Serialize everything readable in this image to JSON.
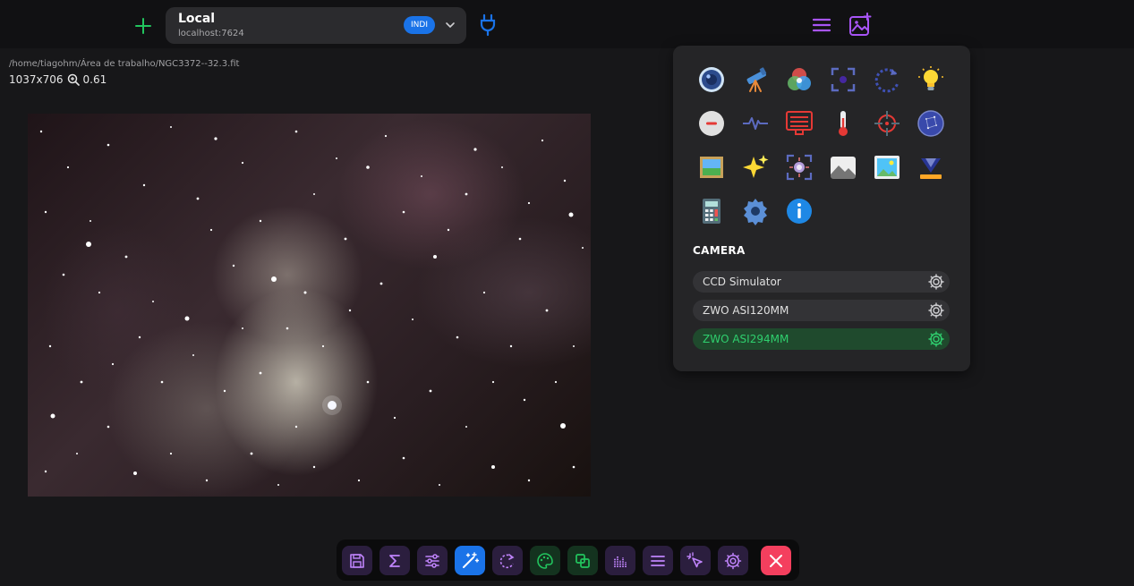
{
  "header": {
    "connection_name": "Local",
    "connection_host": "localhost:7624",
    "connection_badge": "INDI",
    "icons": [
      "add-icon",
      "chevron-down-icon",
      "plug-icon",
      "menu-icon",
      "image-add-icon"
    ],
    "accent_green": "#22c55e",
    "accent_purple": "#a855f7",
    "accent_blue": "#1a73e8"
  },
  "image_info": {
    "path": "/home/tiagohm/Área de trabalho/NGC3372--32.3.fit",
    "resolution": "1037x706",
    "zoom": "0.61"
  },
  "panel": {
    "icons": [
      "camera-lens-icon",
      "telescope-icon",
      "color-filter-icon",
      "focus-icon",
      "rotator-icon",
      "light-bulb-icon",
      "dew-heater-icon",
      "signal-icon",
      "flat-panel-icon",
      "thermometer-icon",
      "crosshair-icon",
      "sky-atlas-icon",
      "framing-icon",
      "sparkles-icon",
      "autofocus-icon",
      "image-icon",
      "image-viewer-icon",
      "dome-icon",
      "calculator-icon",
      "settings-icon",
      "info-icon"
    ],
    "section_title": "CAMERA",
    "cameras": [
      {
        "label": "CCD Simulator",
        "active": false
      },
      {
        "label": "ZWO ASI120MM",
        "active": false
      },
      {
        "label": "ZWO ASI294MM",
        "active": true
      }
    ]
  },
  "dock": {
    "buttons": [
      "save-icon",
      "sigma-icon",
      "sliders-icon",
      "magic-wand-icon",
      "rotate-icon",
      "palette-icon",
      "crop-icon",
      "histogram-icon",
      "list-icon",
      "pointer-icon",
      "settings-icon",
      "close-icon"
    ]
  }
}
